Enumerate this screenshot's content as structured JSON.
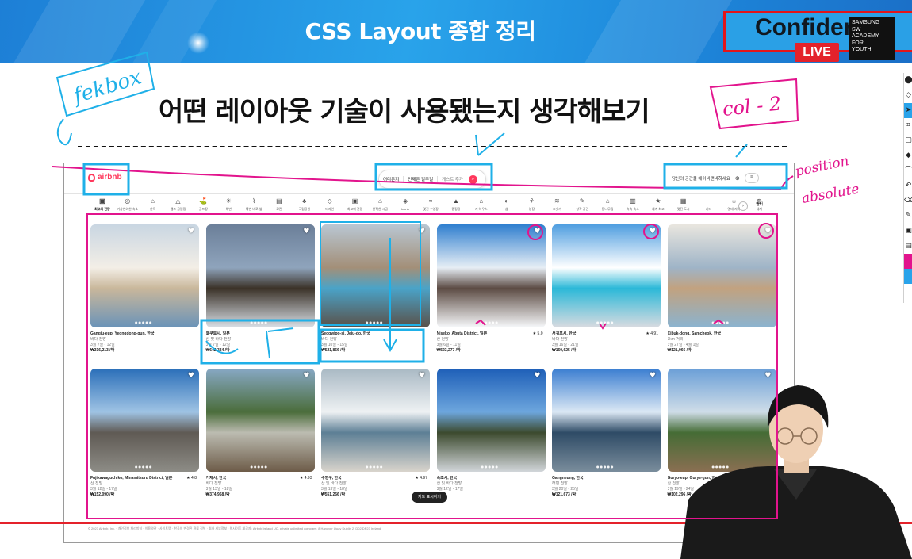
{
  "banner": {
    "title": "CSS Layout 종합 정리",
    "confidential_text": "Confider",
    "live_label": "LIVE",
    "academy_logo_lines": [
      "SAMSUNG",
      "SW",
      "ACADEMY",
      "FOR",
      "YOUTH"
    ]
  },
  "slide": {
    "heading": "어떤 레이아웃 기술이 사용됐는지 생각해보기",
    "annotations": {
      "flexbox": "fekbox",
      "col": "col - 2",
      "position_line1": "position",
      "position_line2": "absolute"
    }
  },
  "airbnb": {
    "logo_text": "airbnb",
    "search": {
      "segment_where": "어디든지",
      "segment_when": "언제든 일주일",
      "segment_guests": "게스트 추가"
    },
    "host_text": "당신의 공간을 에어비앤비하세요",
    "categories": [
      {
        "label": "최고의 전망",
        "icon": "view-icon"
      },
      {
        "label": "기상천외한 숙소",
        "icon": "ufo-icon"
      },
      {
        "label": "한옥",
        "icon": "hanok-icon"
      },
      {
        "label": "캠프 글램핑",
        "icon": "camp-icon"
      },
      {
        "label": "골프장",
        "icon": "golf-icon"
      },
      {
        "label": "해변",
        "icon": "beach-icon"
      },
      {
        "label": "해변 바로 앞",
        "icon": "beachfront-icon"
      },
      {
        "label": "료칸",
        "icon": "ryokan-icon"
      },
      {
        "label": "국립공원",
        "icon": "park-icon"
      },
      {
        "label": "디자인",
        "icon": "design-icon"
      },
      {
        "label": "최고의 전망",
        "icon": "view2-icon"
      },
      {
        "label": "한적한 시골",
        "icon": "countryside-icon"
      },
      {
        "label": "Iconic",
        "icon": "iconic-icon"
      },
      {
        "label": "멋진 수영장",
        "icon": "pool-icon"
      },
      {
        "label": "캠핑장",
        "icon": "camping-icon"
      },
      {
        "label": "키 하우스",
        "icon": "tinyhouse-icon"
      },
      {
        "label": "섬",
        "icon": "island-icon"
      },
      {
        "label": "농장",
        "icon": "farm-icon"
      },
      {
        "label": "호숫가",
        "icon": "lake-icon"
      },
      {
        "label": "창작 공간",
        "icon": "creative-icon"
      },
      {
        "label": "통나무집",
        "icon": "cabin-icon"
      },
      {
        "label": "속속 숙소",
        "icon": "stay-icon"
      },
      {
        "label": "세계 최고",
        "icon": "top-icon"
      },
      {
        "label": "멋진 도시",
        "icon": "city-icon"
      },
      {
        "label": "기타",
        "icon": "other-icon"
      },
      {
        "label": "열대 지역",
        "icon": "tropical-icon"
      },
      {
        "label": "세계",
        "icon": "world-icon"
      }
    ],
    "filter_label": "필터",
    "map_button": "지도 표시하기",
    "footer_text": "© 2023 Airbnb, Inc. · 개인정보 처리방침 · 이용약관 · 사이트맵 · 한국의 변경된 환불 정책 · 회사 세부정보 · 웹사이트 제공자: Airbnb Ireland UC, private unlimited company, 8 Hanover Quay Dublin 2, D02 DP23 Ireland",
    "listings": [
      {
        "location": "Gangju-eup, Yeongdong-gun, 한국",
        "rating": "",
        "sub": "바다 전망",
        "dates": "3월 7일 - 12일",
        "price": "₩316,213 /박",
        "colors": [
          "#c9d6e2",
          "#f3eee6",
          "#c9b79b",
          "#6a93b8"
        ]
      },
      {
        "location": "호쿠토시, 일본",
        "rating": "",
        "sub": "산 및 바다 전망",
        "dates": "3월 7일 - 12일",
        "price": "₩642,334 /박",
        "colors": [
          "#6b7f99",
          "#8fa4bc",
          "#3b3228",
          "#d9dfe6"
        ]
      },
      {
        "location": "Seogwipo-si, Jeju-do, 한국",
        "rating": "",
        "sub": "바다 전망",
        "dates": "3월 10일 - 15일",
        "price": "₩521,866 /박",
        "colors": [
          "#b9c7d3",
          "#a38f78",
          "#4aa3c8",
          "#5a5048"
        ]
      },
      {
        "location": "Niseko, Abuta District, 일본",
        "rating": "★ 5.0",
        "sub": "산 전망",
        "dates": "3월 6일 - 11일",
        "price": "₩523,277 /박",
        "colors": [
          "#2f7fcf",
          "#e7eef5",
          "#5c4b43",
          "#f7f9fb"
        ]
      },
      {
        "location": "서귀포시, 한국",
        "rating": "★ 4.91",
        "sub": "바다 전망",
        "dates": "3월 16일 - 21일",
        "price": "₩160,625 /박",
        "colors": [
          "#4f9ee0",
          "#ffffff",
          "#2bb8d8",
          "#d9dbe0"
        ]
      },
      {
        "location": "Cibuk-dong, Samcheok, 한국",
        "rating": "",
        "sub": "3km 거리",
        "dates": "3월 27일 - 4월 1일",
        "price": "₩121,966 /박",
        "colors": [
          "#e9e6df",
          "#9fb4c7",
          "#c2a27f",
          "#8ab3d0"
        ]
      },
      {
        "location": "Fujikawaguchiko, Minamitsuru District, 일본",
        "rating": "★ 4.8",
        "sub": "산 전망",
        "dates": "3월 12일 - 17일",
        "price": "₩152,090 /박",
        "colors": [
          "#2b6fb9",
          "#9fc3e4",
          "#5f5a54",
          "#8d8c86"
        ]
      },
      {
        "location": "거제시, 한국",
        "rating": "★ 4.93",
        "sub": "바다 전망",
        "dates": "3월 13일 - 18일",
        "price": "₩374,968 /박",
        "colors": [
          "#87a8c4",
          "#4b6d3b",
          "#bcbcb1",
          "#6d5b48"
        ]
      },
      {
        "location": "수영구, 한국",
        "rating": "★ 4.97",
        "sub": "산 및 바다 전망",
        "dates": "3월 13일 - 18일",
        "price": "₩551,266 /박",
        "colors": [
          "#a9b9c4",
          "#eef1f3",
          "#5d7f95",
          "#d9d4cc"
        ]
      },
      {
        "location": "속초시, 한국",
        "rating": "",
        "sub": "산 및 바다 전망",
        "dates": "3월 12일 - 17일",
        "price": "",
        "colors": [
          "#1e5fb8",
          "#6da6dd",
          "#3c4a2e",
          "#d2d6da"
        ]
      },
      {
        "location": "Gangneung, 한국",
        "rating": "",
        "sub": "해변 전망",
        "dates": "3월 20일 - 25일",
        "price": "₩121,673 /박",
        "colors": [
          "#3b7ed1",
          "#dbe8f4",
          "#2e4b66",
          "#7a8d9c"
        ]
      },
      {
        "location": "Guryo-eup, Gurye-gun, 한국",
        "rating": "",
        "sub": "산 전망",
        "dates": "3월 19일 - 24일",
        "price": "₩102,296 /박",
        "colors": [
          "#6b9fd7",
          "#cfdde8",
          "#456c35",
          "#8a6f52"
        ]
      }
    ]
  },
  "toolbar_icons": [
    "eraser-icon",
    "select-icon",
    "cursor-icon",
    "tag-icon",
    "page-icon",
    "highlight-icon",
    "shape-icon",
    "undo-icon",
    "trash-icon",
    "pen-icon",
    "image-icon",
    "doc-icon",
    "color-pink-icon",
    "color-blue-icon"
  ],
  "colors": {
    "banner_blue": "#29a3ea",
    "accent_red": "#e4222b",
    "annotation_cyan": "#1fb0e8",
    "annotation_pink": "#e2148d",
    "airbnb_pink": "#ff385c"
  }
}
